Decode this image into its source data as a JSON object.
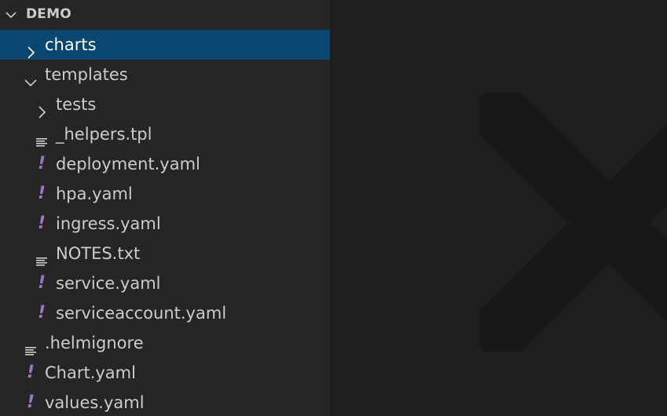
{
  "explorer": {
    "section_title": "DEMO",
    "rows": [
      {
        "label": "charts",
        "type": "folder",
        "expanded": false,
        "selected": true,
        "depth": 0
      },
      {
        "label": "templates",
        "type": "folder",
        "expanded": true,
        "selected": false,
        "depth": 0
      },
      {
        "label": "tests",
        "type": "folder",
        "expanded": false,
        "selected": false,
        "depth": 1
      },
      {
        "label": "_helpers.tpl",
        "type": "text",
        "selected": false,
        "depth": 1
      },
      {
        "label": "deployment.yaml",
        "type": "yaml",
        "selected": false,
        "depth": 1
      },
      {
        "label": "hpa.yaml",
        "type": "yaml",
        "selected": false,
        "depth": 1
      },
      {
        "label": "ingress.yaml",
        "type": "yaml",
        "selected": false,
        "depth": 1
      },
      {
        "label": "NOTES.txt",
        "type": "text",
        "selected": false,
        "depth": 1
      },
      {
        "label": "service.yaml",
        "type": "yaml",
        "selected": false,
        "depth": 1
      },
      {
        "label": "serviceaccount.yaml",
        "type": "yaml",
        "selected": false,
        "depth": 1
      },
      {
        "label": ".helmignore",
        "type": "text",
        "selected": false,
        "depth": 0
      },
      {
        "label": "Chart.yaml",
        "type": "yaml",
        "selected": false,
        "depth": 0
      },
      {
        "label": "values.yaml",
        "type": "yaml",
        "selected": false,
        "depth": 0
      }
    ]
  },
  "colors": {
    "sidebar_bg": "#252526",
    "editor_bg": "#1e1e1e",
    "selection_bg": "#094771",
    "yaml_icon": "#a074c4",
    "text": "#cccccc"
  },
  "icons": {
    "folder_collapsed": "chevron-right-icon",
    "folder_expanded": "chevron-down-icon",
    "text_file": "lines-file-icon",
    "yaml_file": "yaml-exclamation-icon",
    "editor_watermark": "vscode-logo-watermark-icon"
  }
}
